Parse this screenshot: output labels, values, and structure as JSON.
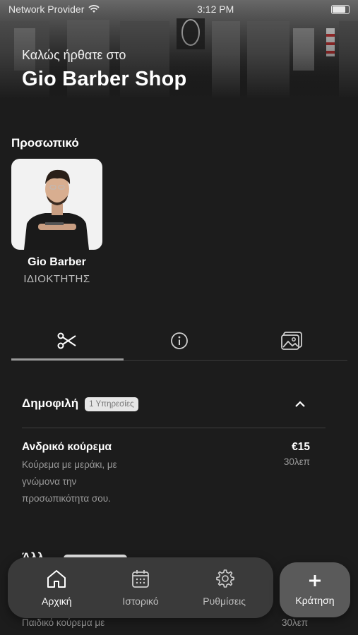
{
  "status_bar": {
    "carrier": "Network Provider",
    "time": "3:12 PM"
  },
  "hero": {
    "welcome": "Καλώς ήρθατε στο",
    "shop_name": "Gio Barber Shop"
  },
  "staff": {
    "section_title": "Προσωπικό",
    "members": [
      {
        "name": "Gio Barber",
        "role": "ΙΔΙΟΚΤΗΤΗΣ"
      }
    ]
  },
  "tabs": [
    {
      "icon": "scissors-icon",
      "active": true
    },
    {
      "icon": "info-icon",
      "active": false
    },
    {
      "icon": "gallery-icon",
      "active": false
    }
  ],
  "services": {
    "category": {
      "title": "Δημοφιλή",
      "badge": "1 Υπηρεσίες"
    },
    "items": [
      {
        "name": "Ανδρικό κούρεμα",
        "price": "€15",
        "description": "Κούρεμα με μεράκι, με γνώμονα την προσωπικότητα σου.",
        "duration": "30λεπ"
      }
    ],
    "category2": {
      "title": "Άλλ"
    },
    "items2": [
      {
        "description": "Παιδικό κούρεμα με",
        "duration": "30λεπ"
      }
    ]
  },
  "bottom_nav": {
    "items": [
      {
        "label": "Αρχική",
        "icon": "home-icon",
        "active": true
      },
      {
        "label": "Ιστορικό",
        "icon": "calendar-icon",
        "active": false
      },
      {
        "label": "Ρυθμίσεις",
        "icon": "gear-icon",
        "active": false
      }
    ],
    "book": {
      "label": "Κράτηση",
      "icon": "plus-icon"
    }
  }
}
